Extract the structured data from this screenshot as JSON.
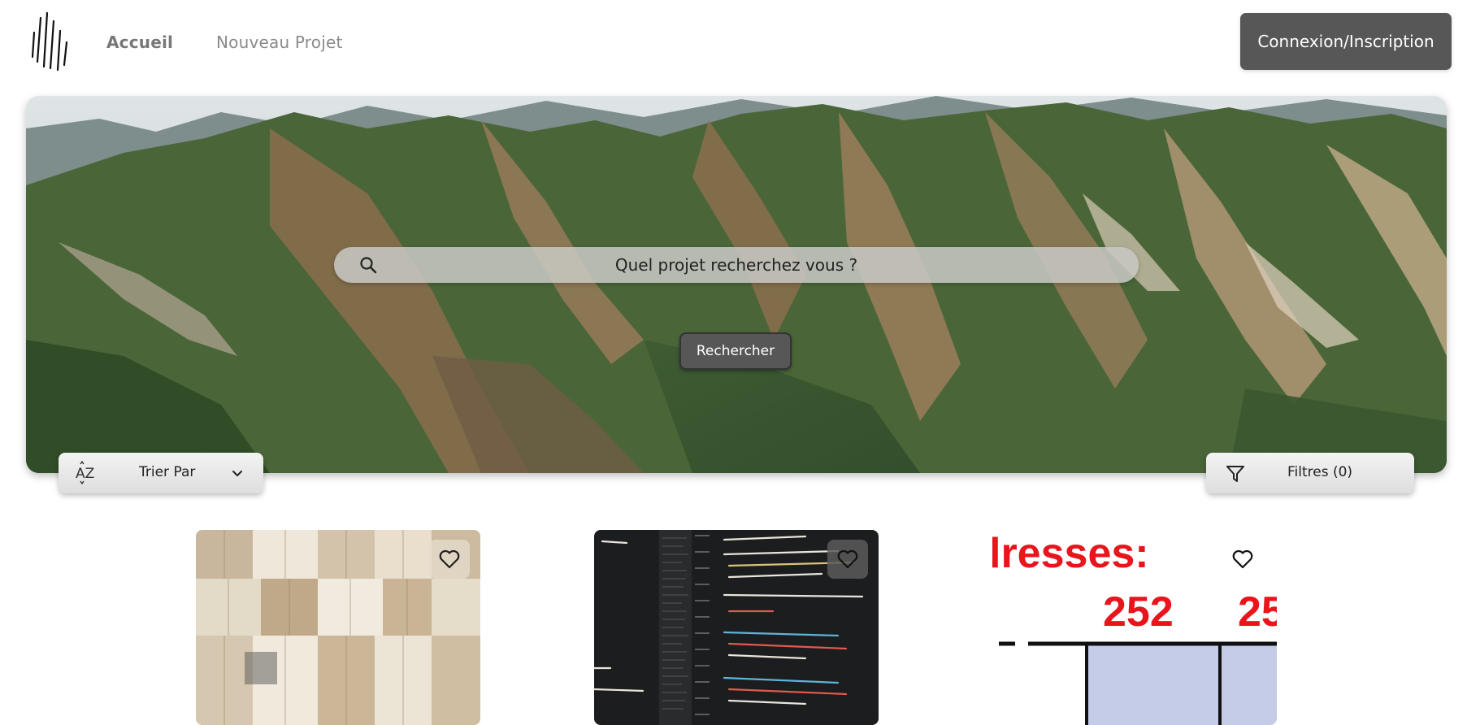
{
  "nav": {
    "home": "Accueil",
    "new_project": "Nouveau Projet",
    "login": "Connexion/Inscription"
  },
  "hero": {
    "search_placeholder": "Quel projet recherchez vous ?",
    "search_button": "Rechercher"
  },
  "toolbar": {
    "sort_label": "Trier Par",
    "sort_icon_text": "AZ",
    "filter_label": "Filtres (0)"
  },
  "cards": [
    {
      "image": "open-books"
    },
    {
      "image": "code-editor"
    },
    {
      "image": "spreadsheet",
      "overlay_text": "lresses:",
      "numbers": [
        "252",
        "25"
      ]
    }
  ],
  "icons": {
    "logo": "logo-icon",
    "search": "search-icon",
    "sort": "sort-az-icon",
    "chevron": "chevron-down-icon",
    "filter": "filter-icon",
    "favorite": "heart-icon"
  },
  "colors": {
    "button_dark": "#575757",
    "pill_light": "#e8e8e8",
    "red_text": "#e8161c",
    "cell_blue": "#c4cce8"
  }
}
